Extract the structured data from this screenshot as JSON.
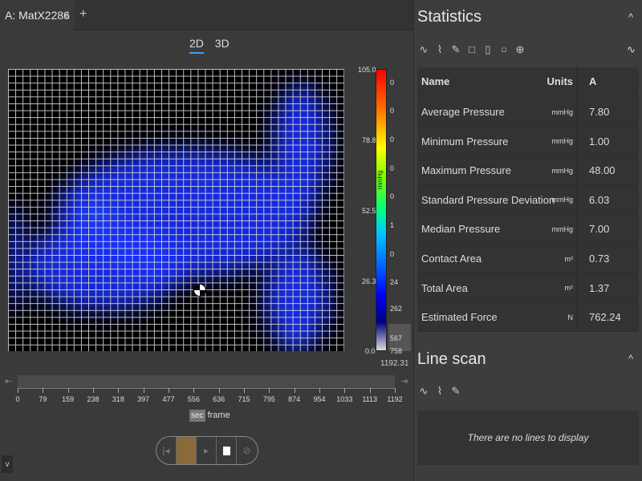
{
  "tabs": [
    {
      "label": "A: MatX2286"
    }
  ],
  "close_glyph": "x",
  "add_glyph": "+",
  "view_toggle": [
    "2D",
    "3D"
  ],
  "active_view": "2D",
  "colorbar": {
    "scale_ticks": [
      "105.0",
      "78.8",
      "52.5",
      "26.3",
      "0.0"
    ],
    "counts": [
      "0",
      "0",
      "0",
      "0",
      "0",
      "1",
      "0",
      "24",
      "262",
      "567",
      "758"
    ],
    "unit_label": "mmHg",
    "max_label": "1192.31"
  },
  "timeline": {
    "start_glyph": "⇤",
    "end_glyph": "⇥",
    "ticks": [
      "0",
      "79",
      "159",
      "238",
      "318",
      "397",
      "477",
      "556",
      "636",
      "715",
      "795",
      "874",
      "954",
      "1033",
      "1113",
      "1192"
    ],
    "unit_sec": "sec",
    "unit_frame": "frame",
    "position": 1192
  },
  "controls": [
    "|◂",
    "■",
    "▸",
    "■",
    "⊘"
  ],
  "collapse_glyph": "v",
  "statistics": {
    "title": "Statistics",
    "tools": [
      "∿",
      "⌇",
      "✎",
      "□",
      "▯",
      "○",
      "⊕"
    ],
    "extra_tool": "∿",
    "header": {
      "name": "Name",
      "unit": "Units",
      "value": "A"
    },
    "rows": [
      {
        "name": "Average Pressure",
        "unit": "mmHg",
        "value": "7.80"
      },
      {
        "name": "Minimum Pressure",
        "unit": "mmHg",
        "value": "1.00"
      },
      {
        "name": "Maximum Pressure",
        "unit": "mmHg",
        "value": "48.00"
      },
      {
        "name": "Standard Pressure Deviation",
        "unit": "mmHg",
        "value": "6.03"
      },
      {
        "name": "Median Pressure",
        "unit": "mmHg",
        "value": "7.00"
      },
      {
        "name": "Contact Area",
        "unit": "m²",
        "value": "0.73"
      },
      {
        "name": "Total Area",
        "unit": "m²",
        "value": "1.37"
      },
      {
        "name": "Estimated Force",
        "unit": "N",
        "value": "762.24"
      }
    ]
  },
  "line_scan": {
    "title": "Line scan",
    "tools": [
      "∿",
      "⌇",
      "✎"
    ],
    "empty_message": "There are no lines to display"
  },
  "chevron_glyph": "^"
}
